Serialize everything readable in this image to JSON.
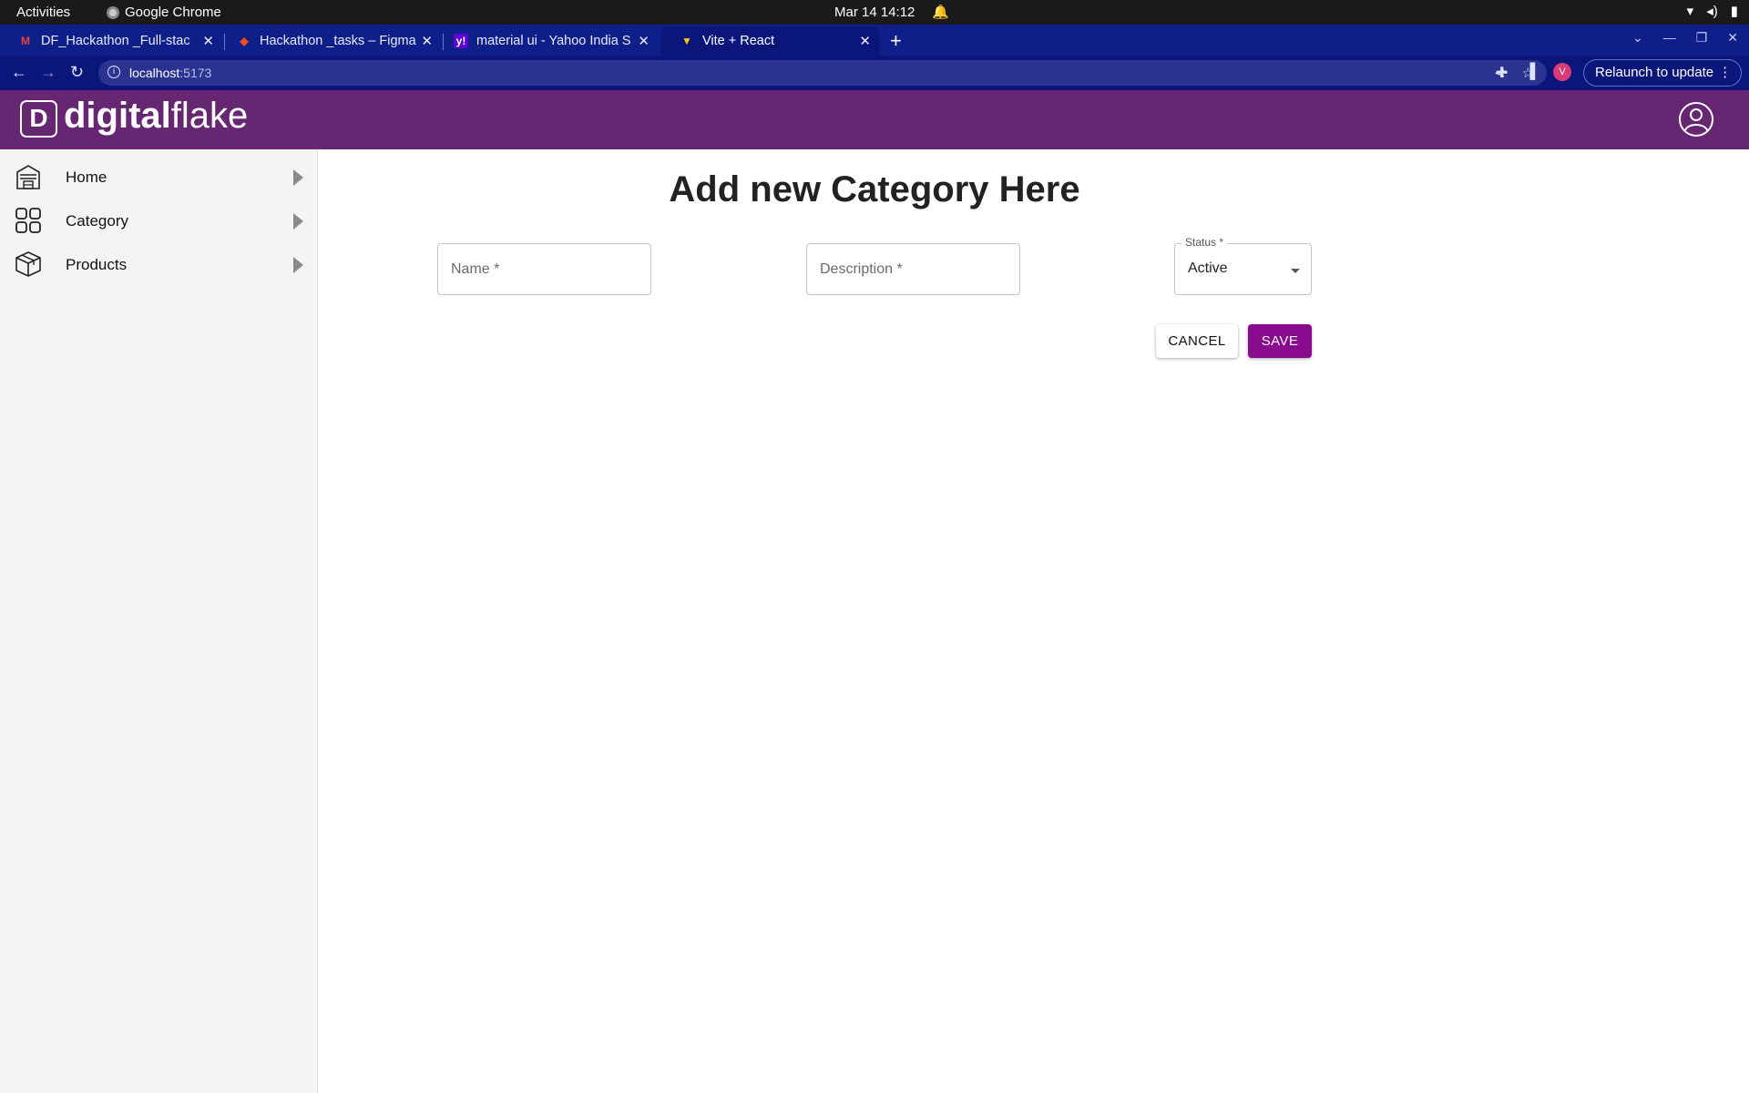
{
  "os_bar": {
    "activities": "Activities",
    "app_name": "Google Chrome",
    "clock": "Mar 14  14:12"
  },
  "browser": {
    "tabs": [
      {
        "title": "DF_Hackathon _Full-stac",
        "favicon": "gmail-icon"
      },
      {
        "title": "Hackathon _tasks – Figma",
        "favicon": "figma-icon"
      },
      {
        "title": "material ui - Yahoo India S",
        "favicon": "yahoo-icon"
      },
      {
        "title": "Vite + React",
        "favicon": "vite-icon",
        "active": true
      }
    ],
    "url_host": "localhost",
    "url_port": ":5173",
    "profile_initial": "V",
    "relaunch_label": "Relaunch to update"
  },
  "app": {
    "brand_bold": "digital",
    "brand_light": "flake",
    "brand_color": "#662671",
    "sidebar": {
      "items": [
        {
          "label": "Home",
          "icon": "home-icon"
        },
        {
          "label": "Category",
          "icon": "category-grid-icon"
        },
        {
          "label": "Products",
          "icon": "products-box-icon"
        }
      ]
    },
    "form": {
      "title": "Add new Category Here",
      "name_placeholder": "Name *",
      "description_placeholder": "Description *",
      "status_label": "Status *",
      "status_value": "Active",
      "cancel_label": "CANCEL",
      "save_label": "SAVE",
      "save_color": "#870b8c"
    }
  }
}
